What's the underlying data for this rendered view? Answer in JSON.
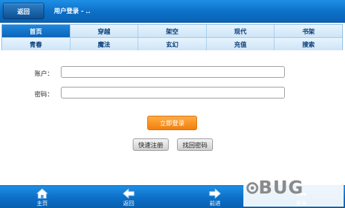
{
  "header": {
    "back_label": "返回",
    "title": "用户登录 - .."
  },
  "nav": {
    "row1": [
      "首页",
      "穿越",
      "架空",
      "现代",
      "书架"
    ],
    "row2": [
      "青春",
      "魔法",
      "玄幻",
      "充值",
      "搜索"
    ]
  },
  "form": {
    "account_label": "账户：",
    "password_label": "密码：",
    "account_value": "",
    "password_value": "",
    "login_label": "立即登录",
    "register_label": "快速注册",
    "recover_label": "找回密码"
  },
  "toolbar": {
    "home": "主页",
    "back": "返回",
    "forward": "前进",
    "more": "更多"
  },
  "watermark": {
    "text": "BUG"
  },
  "colors": {
    "header_blue": "#0c6fc6",
    "nav_light": "#d6ebfb",
    "login_orange": "#f27f0c"
  }
}
